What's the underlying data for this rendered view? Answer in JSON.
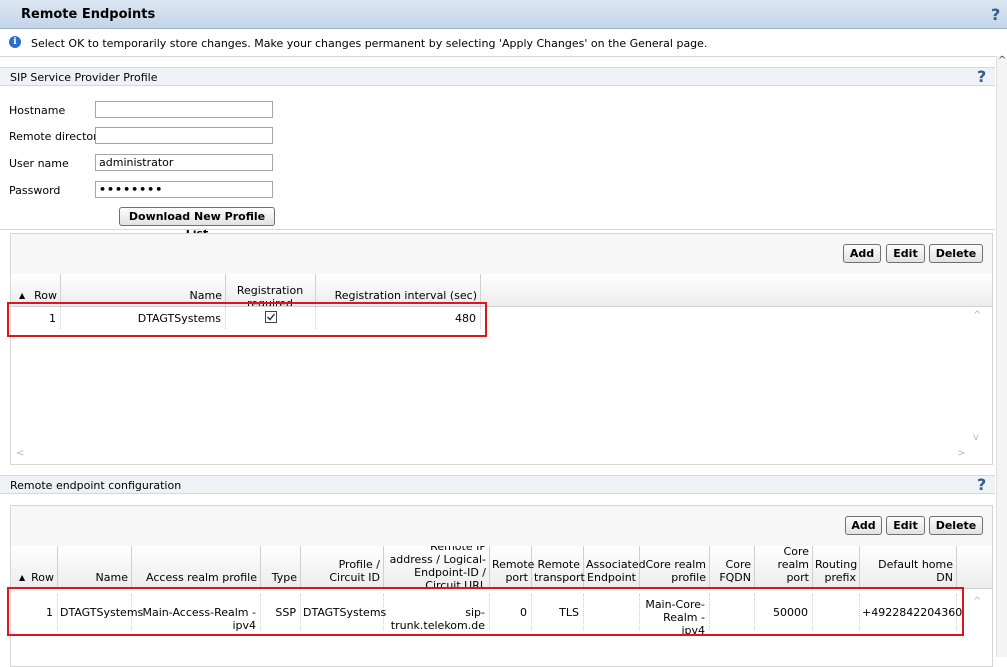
{
  "page": {
    "title": "Remote Endpoints",
    "info_text": "Select OK to temporarily store changes. Make your changes permanent by selecting 'Apply Changes' on the General page.",
    "help_symbol": "?"
  },
  "ssp_section": {
    "title": "SIP Service Provider Profile",
    "fields": {
      "hostname_label": "Hostname",
      "hostname_value": "",
      "remote_dir_label": "Remote directory",
      "remote_dir_value": "",
      "username_label": "User name",
      "username_value": "administrator",
      "password_label": "Password",
      "password_value": "••••••••"
    },
    "download_button": "Download New Profile List",
    "toolbar": {
      "add": "Add",
      "edit": "Edit",
      "delete": "Delete"
    },
    "table": {
      "headers": [
        "Row",
        "Name",
        "Registration required",
        "Registration interval (sec)"
      ],
      "rows": [
        {
          "row": "1",
          "name": "DTAGTSystems",
          "registration_required": true,
          "interval": "480"
        }
      ]
    }
  },
  "rec_section": {
    "title": "Remote endpoint configuration",
    "toolbar": {
      "add": "Add",
      "edit": "Edit",
      "delete": "Delete"
    },
    "table": {
      "headers": [
        "Row",
        "Name",
        "Access realm profile",
        "Type",
        "Profile / Circuit ID",
        "Remote IP address / Logical-Endpoint-ID / Circuit URL",
        "Remote port",
        "Remote transport",
        "Associated Endpoint",
        "Core realm profile",
        "Core FQDN",
        "Core realm port",
        "Routing prefix",
        "Default home DN"
      ],
      "rows": [
        {
          "row": "1",
          "name": "DTAGTSystems",
          "access_realm": "Main-Access-Realm - ipv4",
          "type": "SSP",
          "profile_circuit": "DTAGTSystems",
          "remote_ip": "sip-trunk.telekom.de",
          "remote_port": "0",
          "remote_transport": "TLS",
          "associated_endpoint": "",
          "core_realm_profile": "Main-Core-Realm - ipv4",
          "core_fqdn": "",
          "core_realm_port": "50000",
          "routing_prefix": "",
          "default_home_dn": "+4922842204360"
        }
      ]
    }
  },
  "icons": {
    "sort": "sort-ascending-icon",
    "info": "info-icon",
    "help": "help-icon"
  },
  "colors": {
    "highlight_border": "#e0141b",
    "title_bar": "#c3d4e8",
    "info_icon": "#2a6ecf"
  }
}
